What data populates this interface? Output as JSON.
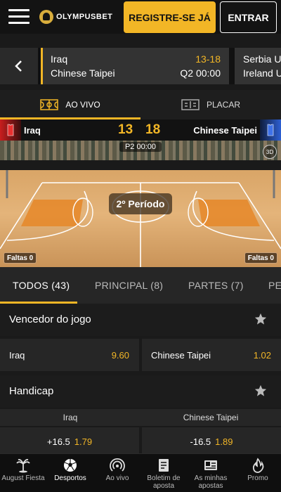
{
  "header": {
    "logo_text": "OLYMPUSBET",
    "register_label": "REGISTRE-SE JÁ",
    "login_label": "ENTRAR"
  },
  "match_strip": {
    "current": {
      "team_a": "Iraq",
      "team_b": "Chinese Taipei",
      "score": "13-18",
      "time": "Q2 00:00"
    },
    "next": {
      "team_a": "Serbia U",
      "team_b": "Ireland U"
    }
  },
  "view_tabs": {
    "live_label": "AO VIVO",
    "score_label": "PLACAR"
  },
  "scoreboard": {
    "team_a": "Iraq",
    "team_b": "Chinese Taipei",
    "score_a": "13",
    "score_b": "18",
    "period_clock": "P2 00:00",
    "period_label": "2º Período",
    "badge": "3D",
    "fouls_a": "Faltas 0",
    "fouls_b": "Faltas 0"
  },
  "market_tabs": [
    {
      "label": "TODOS (43)"
    },
    {
      "label": "PRINCIPAL (8)"
    },
    {
      "label": "PARTES (7)"
    },
    {
      "label": "PE"
    }
  ],
  "markets": {
    "winner": {
      "title": "Vencedor do jogo",
      "team_a": "Iraq",
      "odds_a": "9.60",
      "team_b": "Chinese Taipei",
      "odds_b": "1.02"
    },
    "handicap": {
      "title": "Handicap",
      "col_a": "Iraq",
      "col_b": "Chinese Taipei",
      "line_a": "+16.5",
      "odds_a": "1.79",
      "line_b": "-16.5",
      "odds_b": "1.89"
    }
  },
  "bottom_nav": [
    {
      "label": "August Fiesta",
      "icon": "palm-tree-icon"
    },
    {
      "label": "Desportos",
      "icon": "soccer-ball-icon"
    },
    {
      "label": "Ao vivo",
      "icon": "live-broadcast-icon"
    },
    {
      "label": "Boletim de aposta",
      "icon": "bet-slip-icon"
    },
    {
      "label": "As minhas apostas",
      "icon": "my-bets-icon"
    },
    {
      "label": "Promo",
      "icon": "fire-icon"
    }
  ],
  "colors": {
    "accent": "#f2b626",
    "background": "#1a1a1a",
    "team_a_flag": "#c81e1e",
    "team_b_flag": "#2d5fd3"
  }
}
